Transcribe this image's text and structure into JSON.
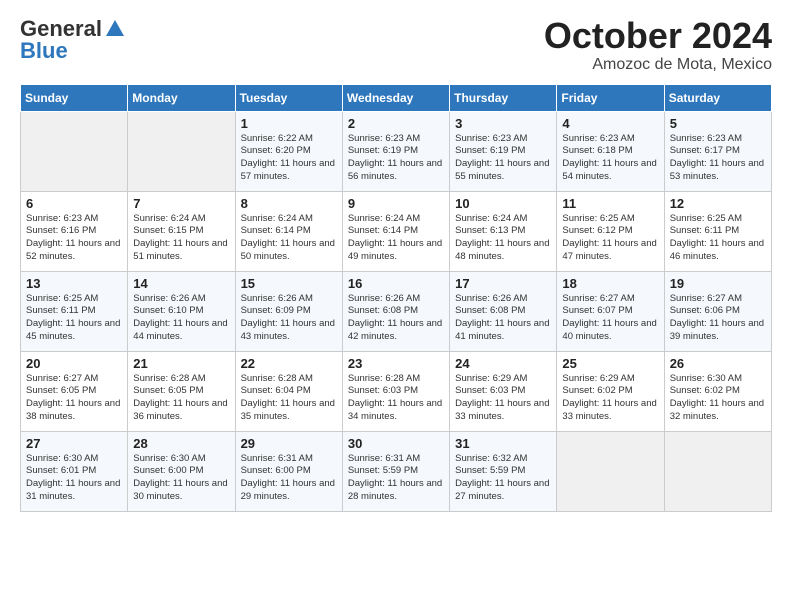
{
  "logo": {
    "general": "General",
    "blue": "Blue"
  },
  "title": "October 2024",
  "location": "Amozoc de Mota, Mexico",
  "days_header": [
    "Sunday",
    "Monday",
    "Tuesday",
    "Wednesday",
    "Thursday",
    "Friday",
    "Saturday"
  ],
  "weeks": [
    [
      {
        "day": "",
        "sunrise": "",
        "sunset": "",
        "daylight": ""
      },
      {
        "day": "",
        "sunrise": "",
        "sunset": "",
        "daylight": ""
      },
      {
        "day": "1",
        "sunrise": "Sunrise: 6:22 AM",
        "sunset": "Sunset: 6:20 PM",
        "daylight": "Daylight: 11 hours and 57 minutes."
      },
      {
        "day": "2",
        "sunrise": "Sunrise: 6:23 AM",
        "sunset": "Sunset: 6:19 PM",
        "daylight": "Daylight: 11 hours and 56 minutes."
      },
      {
        "day": "3",
        "sunrise": "Sunrise: 6:23 AM",
        "sunset": "Sunset: 6:19 PM",
        "daylight": "Daylight: 11 hours and 55 minutes."
      },
      {
        "day": "4",
        "sunrise": "Sunrise: 6:23 AM",
        "sunset": "Sunset: 6:18 PM",
        "daylight": "Daylight: 11 hours and 54 minutes."
      },
      {
        "day": "5",
        "sunrise": "Sunrise: 6:23 AM",
        "sunset": "Sunset: 6:17 PM",
        "daylight": "Daylight: 11 hours and 53 minutes."
      }
    ],
    [
      {
        "day": "6",
        "sunrise": "Sunrise: 6:23 AM",
        "sunset": "Sunset: 6:16 PM",
        "daylight": "Daylight: 11 hours and 52 minutes."
      },
      {
        "day": "7",
        "sunrise": "Sunrise: 6:24 AM",
        "sunset": "Sunset: 6:15 PM",
        "daylight": "Daylight: 11 hours and 51 minutes."
      },
      {
        "day": "8",
        "sunrise": "Sunrise: 6:24 AM",
        "sunset": "Sunset: 6:14 PM",
        "daylight": "Daylight: 11 hours and 50 minutes."
      },
      {
        "day": "9",
        "sunrise": "Sunrise: 6:24 AM",
        "sunset": "Sunset: 6:14 PM",
        "daylight": "Daylight: 11 hours and 49 minutes."
      },
      {
        "day": "10",
        "sunrise": "Sunrise: 6:24 AM",
        "sunset": "Sunset: 6:13 PM",
        "daylight": "Daylight: 11 hours and 48 minutes."
      },
      {
        "day": "11",
        "sunrise": "Sunrise: 6:25 AM",
        "sunset": "Sunset: 6:12 PM",
        "daylight": "Daylight: 11 hours and 47 minutes."
      },
      {
        "day": "12",
        "sunrise": "Sunrise: 6:25 AM",
        "sunset": "Sunset: 6:11 PM",
        "daylight": "Daylight: 11 hours and 46 minutes."
      }
    ],
    [
      {
        "day": "13",
        "sunrise": "Sunrise: 6:25 AM",
        "sunset": "Sunset: 6:11 PM",
        "daylight": "Daylight: 11 hours and 45 minutes."
      },
      {
        "day": "14",
        "sunrise": "Sunrise: 6:26 AM",
        "sunset": "Sunset: 6:10 PM",
        "daylight": "Daylight: 11 hours and 44 minutes."
      },
      {
        "day": "15",
        "sunrise": "Sunrise: 6:26 AM",
        "sunset": "Sunset: 6:09 PM",
        "daylight": "Daylight: 11 hours and 43 minutes."
      },
      {
        "day": "16",
        "sunrise": "Sunrise: 6:26 AM",
        "sunset": "Sunset: 6:08 PM",
        "daylight": "Daylight: 11 hours and 42 minutes."
      },
      {
        "day": "17",
        "sunrise": "Sunrise: 6:26 AM",
        "sunset": "Sunset: 6:08 PM",
        "daylight": "Daylight: 11 hours and 41 minutes."
      },
      {
        "day": "18",
        "sunrise": "Sunrise: 6:27 AM",
        "sunset": "Sunset: 6:07 PM",
        "daylight": "Daylight: 11 hours and 40 minutes."
      },
      {
        "day": "19",
        "sunrise": "Sunrise: 6:27 AM",
        "sunset": "Sunset: 6:06 PM",
        "daylight": "Daylight: 11 hours and 39 minutes."
      }
    ],
    [
      {
        "day": "20",
        "sunrise": "Sunrise: 6:27 AM",
        "sunset": "Sunset: 6:05 PM",
        "daylight": "Daylight: 11 hours and 38 minutes."
      },
      {
        "day": "21",
        "sunrise": "Sunrise: 6:28 AM",
        "sunset": "Sunset: 6:05 PM",
        "daylight": "Daylight: 11 hours and 36 minutes."
      },
      {
        "day": "22",
        "sunrise": "Sunrise: 6:28 AM",
        "sunset": "Sunset: 6:04 PM",
        "daylight": "Daylight: 11 hours and 35 minutes."
      },
      {
        "day": "23",
        "sunrise": "Sunrise: 6:28 AM",
        "sunset": "Sunset: 6:03 PM",
        "daylight": "Daylight: 11 hours and 34 minutes."
      },
      {
        "day": "24",
        "sunrise": "Sunrise: 6:29 AM",
        "sunset": "Sunset: 6:03 PM",
        "daylight": "Daylight: 11 hours and 33 minutes."
      },
      {
        "day": "25",
        "sunrise": "Sunrise: 6:29 AM",
        "sunset": "Sunset: 6:02 PM",
        "daylight": "Daylight: 11 hours and 33 minutes."
      },
      {
        "day": "26",
        "sunrise": "Sunrise: 6:30 AM",
        "sunset": "Sunset: 6:02 PM",
        "daylight": "Daylight: 11 hours and 32 minutes."
      }
    ],
    [
      {
        "day": "27",
        "sunrise": "Sunrise: 6:30 AM",
        "sunset": "Sunset: 6:01 PM",
        "daylight": "Daylight: 11 hours and 31 minutes."
      },
      {
        "day": "28",
        "sunrise": "Sunrise: 6:30 AM",
        "sunset": "Sunset: 6:00 PM",
        "daylight": "Daylight: 11 hours and 30 minutes."
      },
      {
        "day": "29",
        "sunrise": "Sunrise: 6:31 AM",
        "sunset": "Sunset: 6:00 PM",
        "daylight": "Daylight: 11 hours and 29 minutes."
      },
      {
        "day": "30",
        "sunrise": "Sunrise: 6:31 AM",
        "sunset": "Sunset: 5:59 PM",
        "daylight": "Daylight: 11 hours and 28 minutes."
      },
      {
        "day": "31",
        "sunrise": "Sunrise: 6:32 AM",
        "sunset": "Sunset: 5:59 PM",
        "daylight": "Daylight: 11 hours and 27 minutes."
      },
      {
        "day": "",
        "sunrise": "",
        "sunset": "",
        "daylight": ""
      },
      {
        "day": "",
        "sunrise": "",
        "sunset": "",
        "daylight": ""
      }
    ]
  ]
}
